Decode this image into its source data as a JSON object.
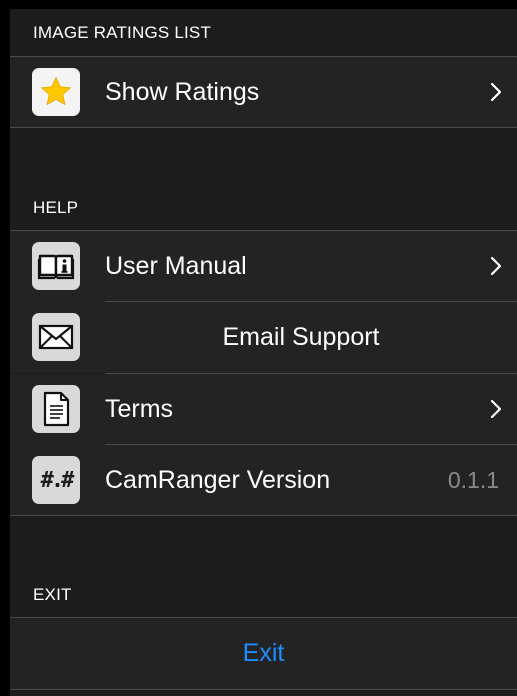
{
  "sections": {
    "ratings_header": "IMAGE RATINGS LIST",
    "help_header": "HELP",
    "exit_header": "EXIT"
  },
  "ratings": {
    "show_ratings_label": "Show Ratings",
    "show_ratings_icon": "star-icon"
  },
  "help": {
    "user_manual_label": "User Manual",
    "user_manual_icon": "book-info-icon",
    "email_support_label": "Email Support",
    "email_support_icon": "envelope-icon",
    "terms_label": "Terms",
    "terms_icon": "document-icon",
    "version_label": "CamRanger Version",
    "version_icon": "hash-icon",
    "version_icon_text": "#.#",
    "version_value": "0.1.1"
  },
  "exit": {
    "exit_label": "Exit"
  },
  "colors": {
    "background": "#1c1c1c",
    "row_background": "#232323",
    "separator": "#4a4a4a",
    "exit_link": "#1e8cff",
    "star_fill": "#ffc800"
  }
}
